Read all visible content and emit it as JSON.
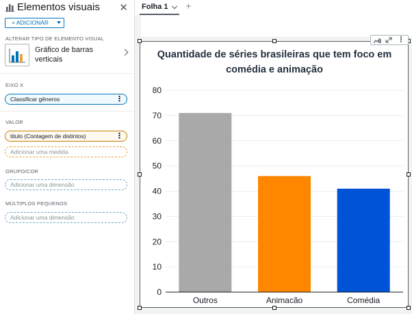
{
  "panel": {
    "title": "Elementos visuais",
    "add_label": "+ ADICIONAR",
    "change_type_label": "ALTERAR TIPO DE ELEMENTO VISUAL",
    "visual_type_line1": "Gráfico de barras",
    "visual_type_line2": "verticais",
    "x_axis_label": "EIXO X",
    "x_axis_field": "Classificar gêneros",
    "value_label": "VALOR",
    "value_field": "titulo (Contagem de distintos)",
    "value_placeholder": "Adicionar uma medida",
    "group_label": "GRUPO/COR",
    "group_placeholder": "Adicionar uma dimensão",
    "small_multiples_label": "MÚLTIPLOS PEQUENOS",
    "small_multiples_placeholder": "Adicionar uma dimensão"
  },
  "tabs": {
    "sheets": [
      "Folha 1"
    ],
    "add_icon": "plus-icon"
  },
  "colors": {
    "accent": "#0073bb",
    "value_well": "#c47d00"
  },
  "chart_data": {
    "type": "bar",
    "title": "Quantidade de séries brasileiras que tem foco em comédia e animação",
    "title_line1": "Quantidade de séries brasileiras que tem foco em",
    "title_line2": "comédia e animação",
    "categories": [
      "Outros",
      "Animacão",
      "Comédia"
    ],
    "values": [
      71,
      46,
      41
    ],
    "colors": [
      "#a9a9a9",
      "#ff8700",
      "#0053d6"
    ],
    "ylim": [
      0,
      80
    ],
    "yticks": [
      "0",
      "10",
      "20",
      "30",
      "40",
      "50",
      "60",
      "70",
      "80"
    ],
    "xlabel": "",
    "ylabel": "",
    "grid": true,
    "legend": "none"
  }
}
